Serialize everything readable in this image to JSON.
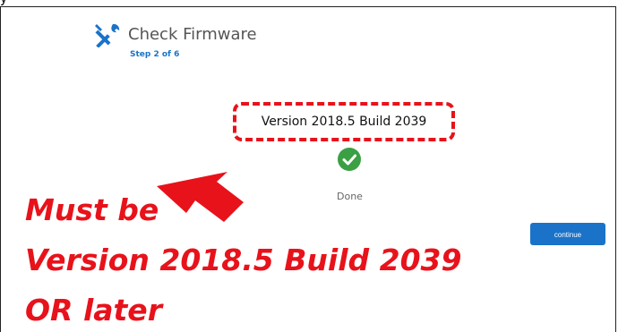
{
  "header": {
    "title": "Check Firmware",
    "step": "Step 2 of 6",
    "top_cut_text": "y"
  },
  "main": {
    "version": "Version 2018.5 Build 2039",
    "status": "Done",
    "continue_label": "continue"
  },
  "callout": {
    "line1": "Must be",
    "line2": "Version 2018.5 Build 2039",
    "line3": "OR later"
  },
  "colors": {
    "accent": "#1a73c9",
    "annotation_red": "#e8121b",
    "success": "#3aa043"
  },
  "icons": {
    "tool": "wrench-screwdriver-icon",
    "status": "checkmark-circle-icon",
    "annotation": "arrow-icon"
  }
}
